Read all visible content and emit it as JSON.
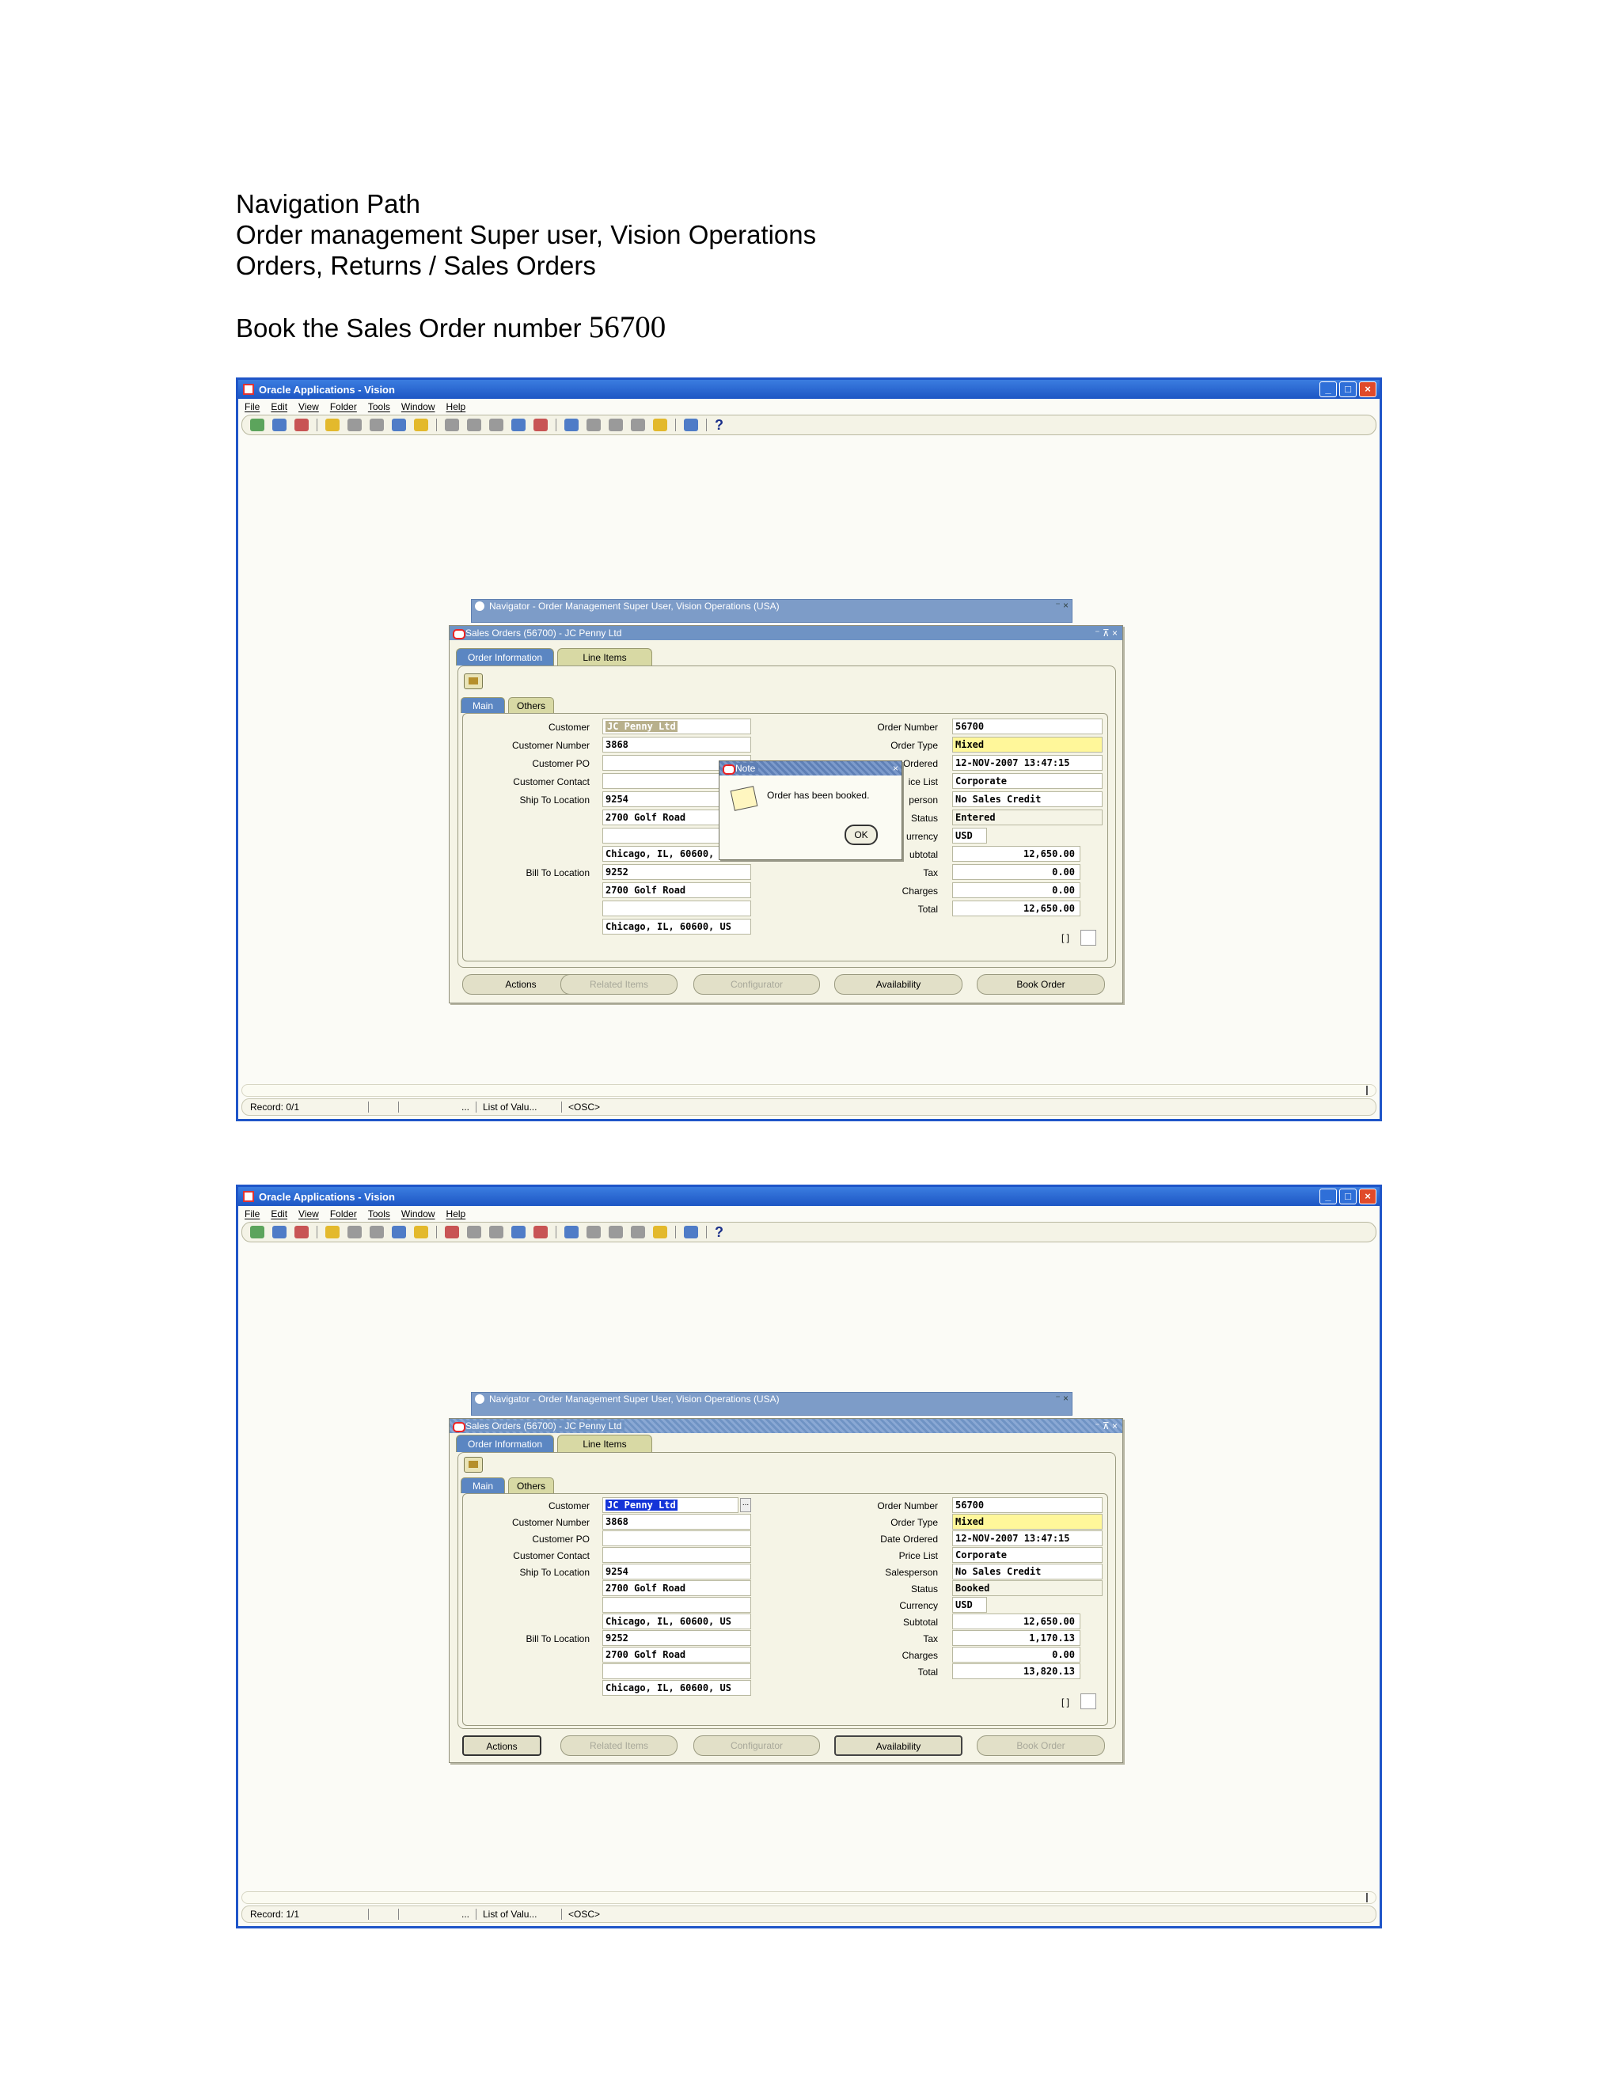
{
  "intro": {
    "lines": [
      "Navigation Path",
      "Order management Super user, Vision Operations",
      "Orders, Returns / Sales Orders"
    ],
    "book_text": "Book the Sales Order number",
    "order_no": "56700"
  },
  "app": {
    "title": "Oracle Applications - Vision",
    "window_buttons": [
      "_",
      "□",
      "×"
    ],
    "menu": [
      "File",
      "Edit",
      "View",
      "Folder",
      "Tools",
      "Window",
      "Help"
    ],
    "help_glyph": "?"
  },
  "navigator": {
    "title": "Navigator - Order Management Super User, Vision Operations (USA)",
    "controls": "⁻ ×"
  },
  "sales_order": {
    "title": "Sales Orders (56700) - JC Penny Ltd",
    "controls": "⁻ ⊼ ×",
    "tabs": [
      "Order Information",
      "Line Items"
    ],
    "subtabs": [
      "Main",
      "Others"
    ],
    "labels": {
      "customer": "Customer",
      "customer_number": "Customer Number",
      "customer_po": "Customer PO",
      "customer_contact": "Customer Contact",
      "ship_to": "Ship To Location",
      "bill_to": "Bill To Location",
      "order_number": "Order Number",
      "order_type": "Order Type",
      "date_ordered": "Date Ordered",
      "price_list": "Price List",
      "salesperson": "Salesperson",
      "status": "Status",
      "currency": "Currency",
      "subtotal": "Subtotal",
      "tax": "Tax",
      "charges": "Charges",
      "total": "Total"
    },
    "partial_labels": {
      "date_ordered": "Ordered",
      "price_list": "ice List",
      "salesperson": "person",
      "status": "Status",
      "currency": "urrency",
      "subtotal": "ubtotal"
    },
    "lov": "...",
    "checkbox_label": "[ ]",
    "buttons": [
      "Actions",
      "Related Items",
      "Configurator",
      "Availability",
      "Book Order"
    ]
  },
  "before": {
    "customer": "JC Penny Ltd",
    "customer_number": "3868",
    "ship_to": [
      "9254",
      "2700 Golf Road",
      "",
      "Chicago, IL, 60600,"
    ],
    "bill_to": [
      "9252",
      "2700 Golf Road",
      "",
      "Chicago, IL, 60600, US"
    ],
    "order_number": "56700",
    "order_type": "Mixed",
    "date_ordered": "12-NOV-2007 13:47:15",
    "price_list": "Corporate",
    "salesperson": "No Sales Credit",
    "status": "Entered",
    "currency": "USD",
    "subtotal": "12,650.00",
    "tax": "0.00",
    "charges": "0.00",
    "total": "12,650.00",
    "note": {
      "title": "Note",
      "message": "Order has been booked.",
      "ok": "OK"
    },
    "status_bar": [
      "Record: 0/1",
      "",
      "...",
      "List of Valu...",
      "<OSC>"
    ]
  },
  "after": {
    "customer": "JC Penny Ltd",
    "customer_number": "3868",
    "ship_to": [
      "9254",
      "2700 Golf Road",
      "",
      "Chicago, IL, 60600, US"
    ],
    "bill_to": [
      "9252",
      "2700 Golf Road",
      "",
      "Chicago, IL, 60600, US"
    ],
    "order_number": "56700",
    "order_type": "Mixed",
    "date_ordered": "12-NOV-2007 13:47:15",
    "price_list": "Corporate",
    "salesperson": "No Sales Credit",
    "status": "Booked",
    "currency": "USD",
    "subtotal": "12,650.00",
    "tax": "1,170.13",
    "charges": "0.00",
    "total": "13,820.13",
    "status_bar": [
      "Record: 1/1",
      "",
      "...",
      "List of Valu...",
      "<OSC>"
    ]
  }
}
